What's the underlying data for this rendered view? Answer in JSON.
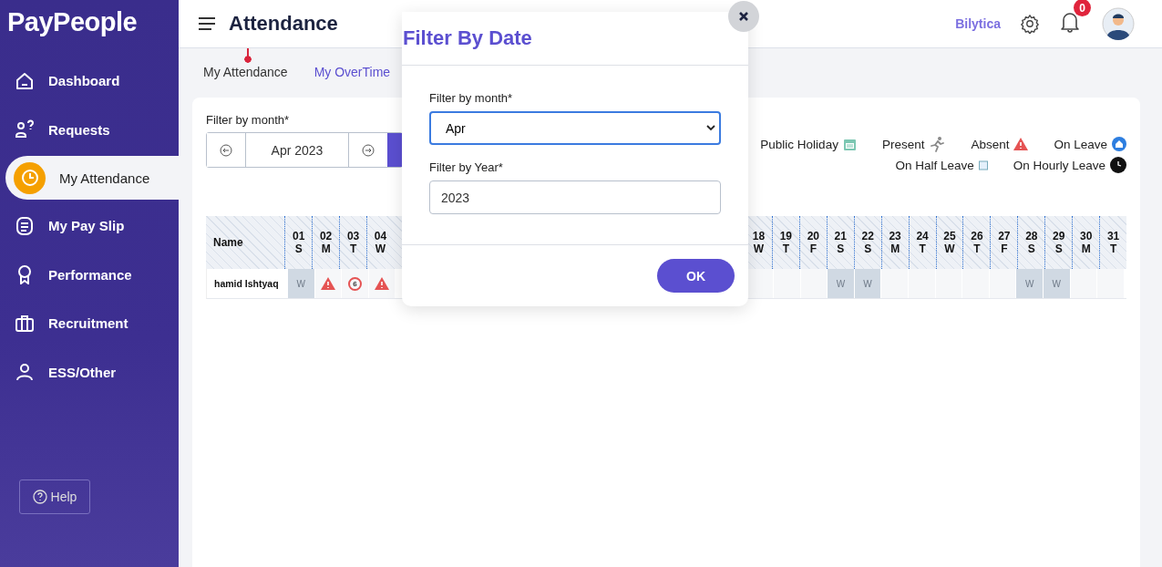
{
  "brand": {
    "logo": "PayPeople"
  },
  "sidebar": {
    "items": [
      {
        "label": "Dashboard",
        "selected": false
      },
      {
        "label": "Requests",
        "selected": false
      },
      {
        "label": "My Attendance",
        "selected": true
      },
      {
        "label": "My Pay Slip",
        "selected": false
      },
      {
        "label": "Performance",
        "selected": false
      },
      {
        "label": "Recruitment",
        "selected": false
      },
      {
        "label": "ESS/Other",
        "selected": false
      }
    ],
    "help": "Help"
  },
  "header": {
    "title": "Attendance",
    "company": "Bilytica",
    "notifications": "0"
  },
  "tabs": [
    {
      "label": "My Attendance",
      "selected": true
    },
    {
      "label": "My OverTime",
      "selected": false
    }
  ],
  "filter": {
    "label": "Filter by month*",
    "value": "Apr 2023"
  },
  "legend": [
    {
      "label": "Public Holiday",
      "kind": "holiday"
    },
    {
      "label": "Present",
      "kind": "present"
    },
    {
      "label": "Absent",
      "kind": "absent"
    },
    {
      "label": "On Leave",
      "kind": "leave"
    },
    {
      "label": "On Half Leave",
      "kind": "half"
    },
    {
      "label": "On Hourly Leave",
      "kind": "hourly"
    }
  ],
  "table": {
    "name_header": "Name",
    "days_before": [
      {
        "date": "01",
        "weekday": "S"
      },
      {
        "date": "02",
        "weekday": "M"
      },
      {
        "date": "03",
        "weekday": "T"
      },
      {
        "date": "04",
        "weekday": "W"
      }
    ],
    "days_after": [
      {
        "date": "18",
        "weekday": "W"
      },
      {
        "date": "19",
        "weekday": "T"
      },
      {
        "date": "20",
        "weekday": "F"
      },
      {
        "date": "21",
        "weekday": "S"
      },
      {
        "date": "22",
        "weekday": "S"
      },
      {
        "date": "23",
        "weekday": "M"
      },
      {
        "date": "24",
        "weekday": "T"
      },
      {
        "date": "25",
        "weekday": "W"
      },
      {
        "date": "26",
        "weekday": "T"
      },
      {
        "date": "27",
        "weekday": "F"
      },
      {
        "date": "28",
        "weekday": "S"
      },
      {
        "date": "29",
        "weekday": "S"
      },
      {
        "date": "30",
        "weekday": "M"
      },
      {
        "date": "31",
        "weekday": "T"
      }
    ],
    "rows": [
      {
        "name": "hamid Ishtyaq",
        "cells_before": [
          {
            "kind": "weekend",
            "text": "W"
          },
          {
            "kind": "absent"
          },
          {
            "kind": "late",
            "text": "6"
          },
          {
            "kind": "absent"
          }
        ],
        "cells_after": [
          {
            "kind": "empty"
          },
          {
            "kind": "empty"
          },
          {
            "kind": "empty"
          },
          {
            "kind": "weekend",
            "text": "W"
          },
          {
            "kind": "weekend",
            "text": "W"
          },
          {
            "kind": "empty"
          },
          {
            "kind": "empty"
          },
          {
            "kind": "empty"
          },
          {
            "kind": "empty"
          },
          {
            "kind": "empty"
          },
          {
            "kind": "weekend",
            "text": "W"
          },
          {
            "kind": "weekend",
            "text": "W"
          },
          {
            "kind": "empty"
          },
          {
            "kind": "empty"
          }
        ]
      }
    ]
  },
  "dialog": {
    "title": "Filter By Date",
    "month_label": "Filter by month*",
    "month_value": "Apr",
    "year_label": "Filter by Year*",
    "year_value": "2023",
    "ok": "OK"
  }
}
